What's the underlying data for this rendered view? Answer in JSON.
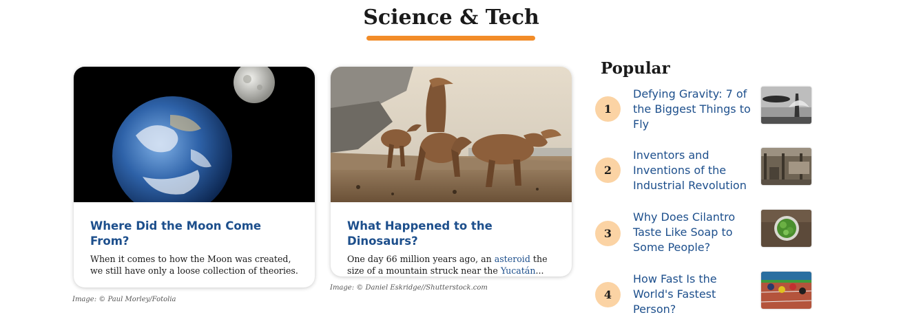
{
  "section": {
    "title": "Science & Tech",
    "accent_color": "#f28c28"
  },
  "cards": [
    {
      "title": "Where Did the Moon Come From?",
      "description": "When it comes to how the Moon was created, we still have only a loose collection of theories.",
      "credit": "Image: © Paul Morley/Fotolia"
    },
    {
      "title": "What Happened to the Dinosaurs?",
      "description_before": "One day 66 million years ago, an ",
      "link1": "asteroid",
      "description_middle": " the size of a mountain struck near the ",
      "link2": "Yucatán",
      "description_after": "...",
      "credit": "Image: © Daniel Eskridge//Shutterstock.com"
    }
  ],
  "popular": {
    "heading": "Popular",
    "items": [
      {
        "number": "1",
        "title": "Defying Gravity: 7 of the Biggest Things to Fly"
      },
      {
        "number": "2",
        "title": "Inventors and Inventions of the Industrial Revolution"
      },
      {
        "number": "3",
        "title": "Why Does Cilantro Taste Like Soap to Some People?"
      },
      {
        "number": "4",
        "title": "How Fast Is the World's Fastest Person?"
      }
    ]
  },
  "colors": {
    "link": "#1d4f8c",
    "number_badge": "#fbd3a4"
  }
}
